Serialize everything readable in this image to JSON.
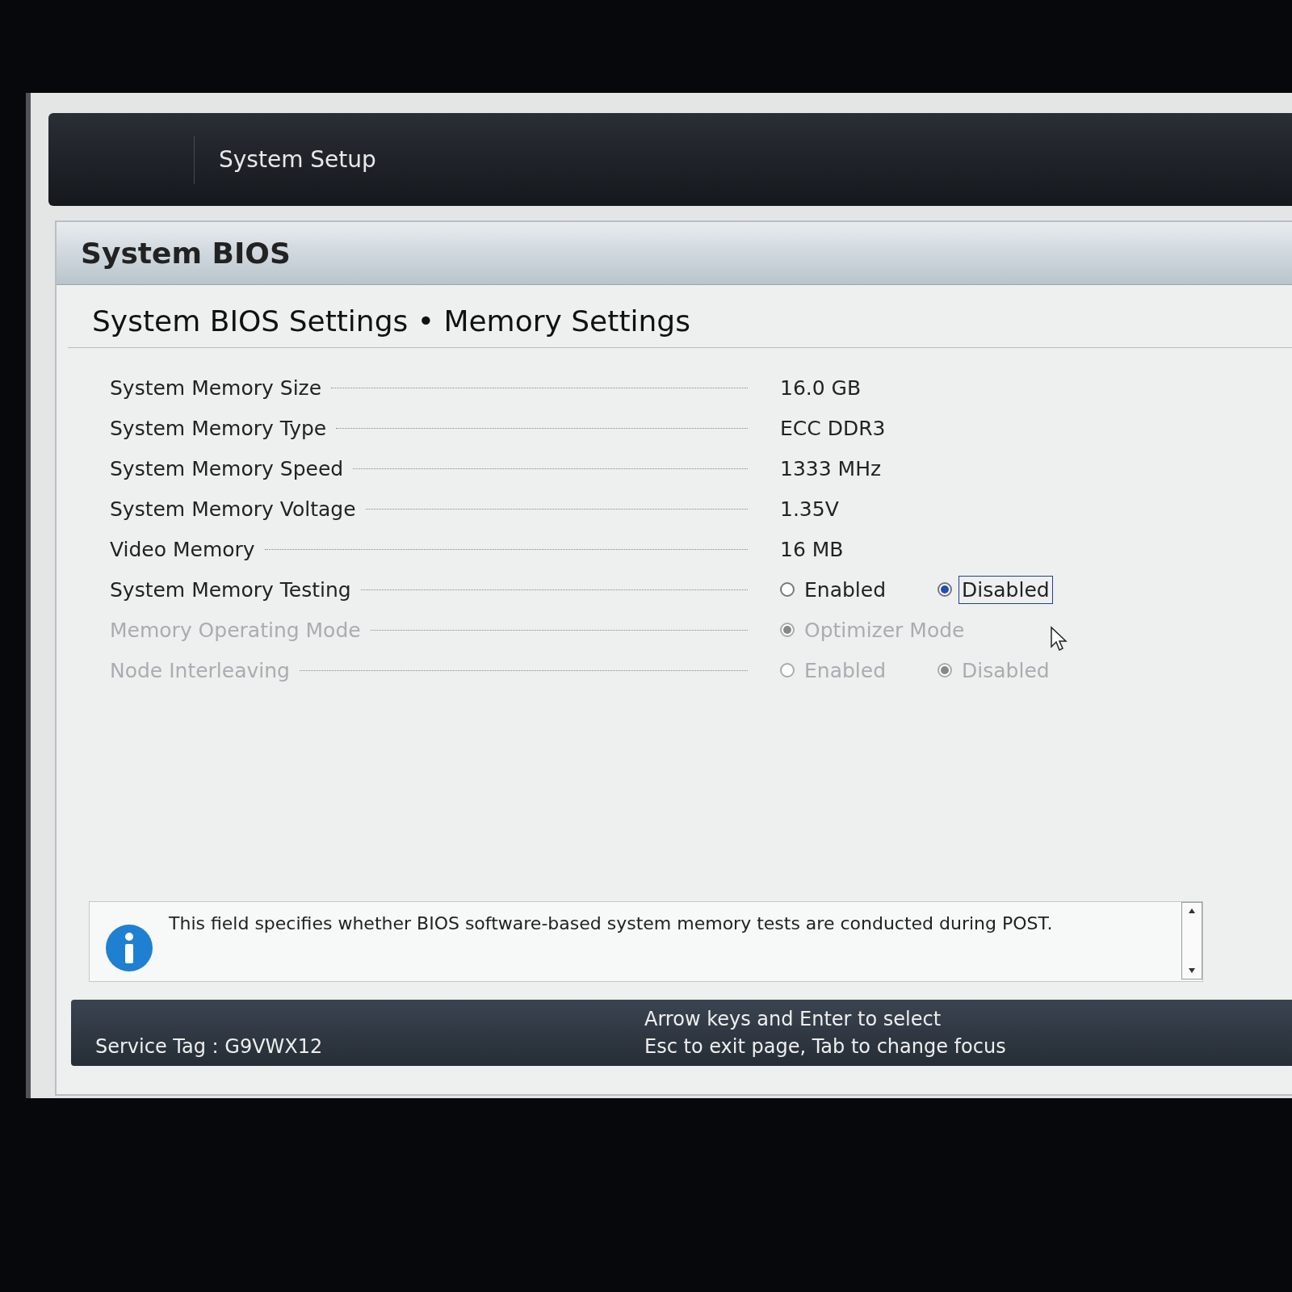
{
  "header": {
    "title": "System Setup"
  },
  "page": {
    "title": "System BIOS",
    "breadcrumb": "System BIOS Settings • Memory Settings"
  },
  "rows": [
    {
      "label": "System Memory Size",
      "kind": "value",
      "value": "16.0 GB",
      "disabled": false
    },
    {
      "label": "System Memory Type",
      "kind": "value",
      "value": "ECC DDR3",
      "disabled": false
    },
    {
      "label": "System Memory Speed",
      "kind": "value",
      "value": "1333 MHz",
      "disabled": false
    },
    {
      "label": "System Memory Voltage",
      "kind": "value",
      "value": "1.35V",
      "disabled": false
    },
    {
      "label": "Video Memory",
      "kind": "value",
      "value": "16 MB",
      "disabled": false
    },
    {
      "label": "System Memory Testing",
      "kind": "radio",
      "disabled": false,
      "options": [
        {
          "label": "Enabled",
          "selected": false,
          "focused": false
        },
        {
          "label": "Disabled",
          "selected": true,
          "focused": true
        }
      ]
    },
    {
      "label": "Memory Operating Mode",
      "kind": "radio",
      "disabled": true,
      "options": [
        {
          "label": "Optimizer Mode",
          "selected": true,
          "focused": false
        }
      ]
    },
    {
      "label": "Node Interleaving",
      "kind": "radio",
      "disabled": true,
      "options": [
        {
          "label": "Enabled",
          "selected": false,
          "focused": false
        },
        {
          "label": "Disabled",
          "selected": true,
          "focused": false
        }
      ]
    }
  ],
  "help": {
    "text": "This field specifies whether BIOS software-based system memory tests are conducted during POST."
  },
  "status_bar": {
    "service_tag": "Service Tag : G9VWX12",
    "hints": [
      "Arrow keys and Enter to select",
      "Esc to exit page, Tab to change focus"
    ]
  }
}
